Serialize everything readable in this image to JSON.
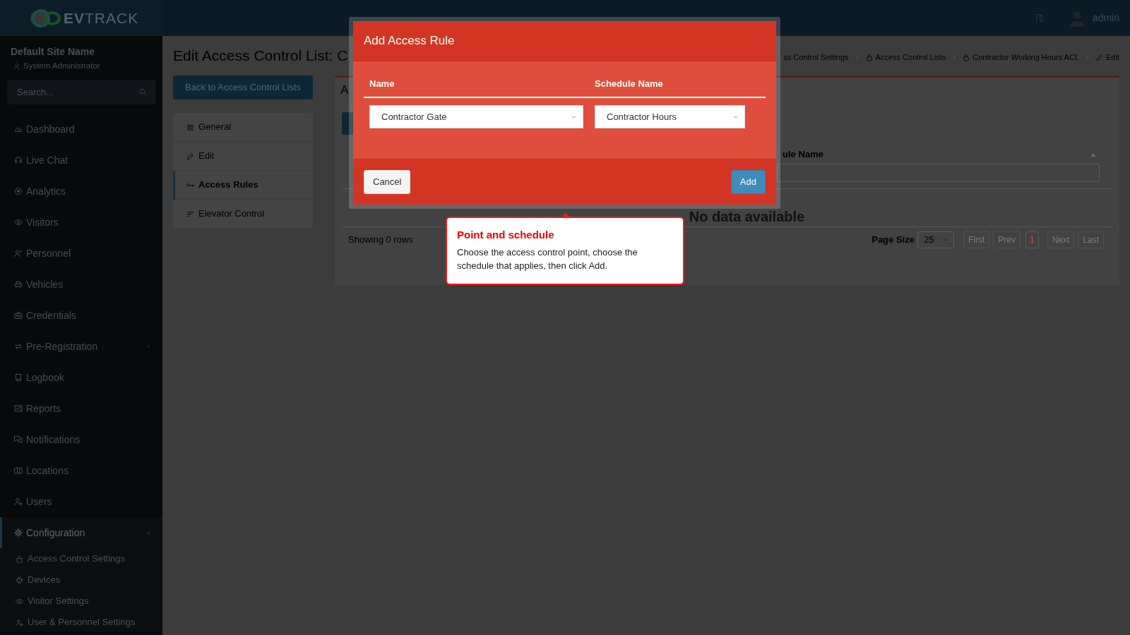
{
  "topbar": {
    "logo": "**EV**TRACK",
    "user_name": "admin"
  },
  "sidebar": {
    "site_name": "Default Site Name",
    "role": "System Administrator",
    "search": {
      "placeholder": "Search..."
    },
    "items": [
      {
        "label": "Dashboard",
        "selected": false,
        "expandable": false
      },
      {
        "label": "Live Chat",
        "selected": false,
        "expandable": false
      },
      {
        "label": "Analytics",
        "selected": false,
        "expandable": false
      },
      {
        "label": "Visitors",
        "selected": false,
        "expandable": false
      },
      {
        "label": "Personnel",
        "selected": false,
        "expandable": false
      },
      {
        "label": "Vehicles",
        "selected": false,
        "expandable": false
      },
      {
        "label": "Credentials",
        "selected": false,
        "expandable": false
      },
      {
        "label": "Pre-Registration",
        "selected": false,
        "expandable": true
      },
      {
        "label": "Logbook",
        "selected": false,
        "expandable": false
      },
      {
        "label": "Reports",
        "selected": false,
        "expandable": false
      },
      {
        "label": "Notifications",
        "selected": false,
        "expandable": false
      },
      {
        "label": "Locations",
        "selected": false,
        "expandable": false
      },
      {
        "label": "Users",
        "selected": false,
        "expandable": false
      },
      {
        "label": "Configuration",
        "selected": true,
        "expandable": true,
        "children": [
          {
            "label": "Access Control Settings",
            "selected": false
          },
          {
            "label": "Devices",
            "selected": false
          },
          {
            "label": "Visitor Settings",
            "selected": false
          },
          {
            "label": "User & Personnel Settings",
            "selected": false
          }
        ]
      }
    ]
  },
  "page": {
    "title": "Edit Access Control List: C",
    "breadcrumb": [
      "ss Control Settings",
      "Access Control Lists",
      "Contractor Working Hours ACL",
      "Edit"
    ],
    "back_button": "Back to Access Control Lists",
    "tabs": [
      {
        "label": "General",
        "selected": false
      },
      {
        "label": "Edit",
        "selected": false
      },
      {
        "label": "Access Rules",
        "selected": true
      },
      {
        "label": "Elevator Control",
        "selected": false
      }
    ],
    "card": {
      "title": "A",
      "columns": [
        "ule Name"
      ],
      "empty_text": "No data available",
      "rows_text": "Showing 0 rows",
      "page_size_label": "Page Size",
      "page_size": "25",
      "pager": [
        {
          "label": "First",
          "selected": false
        },
        {
          "label": "Prev",
          "selected": false
        },
        {
          "label": "1",
          "selected": true
        },
        {
          "label": "Next",
          "selected": false
        },
        {
          "label": "Last",
          "selected": false
        }
      ]
    }
  },
  "modal": {
    "title": "Add Access Rule",
    "columns": [
      "Name",
      "Schedule Name"
    ],
    "fields": [
      {
        "value": "Contractor Gate"
      },
      {
        "value": "Contractor Hours"
      }
    ],
    "buttons": [
      {
        "label": "Cancel",
        "kind": "default"
      },
      {
        "label": "Add",
        "kind": "primary"
      }
    ]
  },
  "tooltip": {
    "title": "Point and schedule",
    "text": "Choose the access control point, choose the schedule that applies, then click Add."
  }
}
